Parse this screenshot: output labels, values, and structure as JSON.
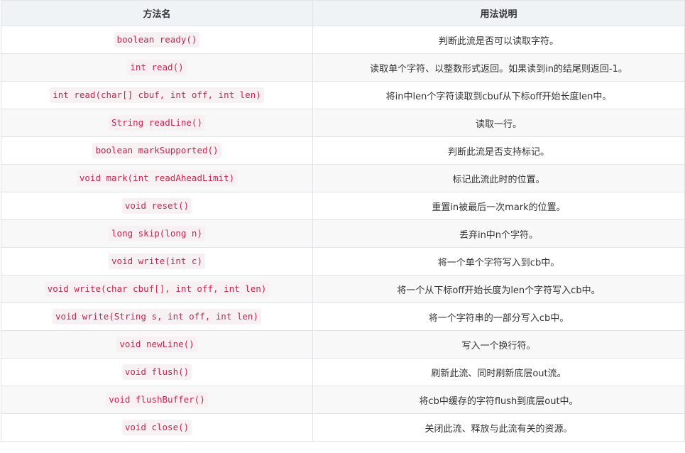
{
  "table": {
    "headers": {
      "method": "方法名",
      "description": "用法说明"
    },
    "rows": [
      {
        "method": "boolean ready()",
        "description": "判断此流是否可以读取字符。"
      },
      {
        "method": "int read()",
        "description": "读取单个字符、以整数形式返回。如果读到in的结尾则返回-1。"
      },
      {
        "method": "int read(char[] cbuf, int off, int len)",
        "description": "将in中len个字符读取到cbuf从下标off开始长度len中。"
      },
      {
        "method": "String readLine()",
        "description": "读取一行。"
      },
      {
        "method": "boolean markSupported()",
        "description": "判断此流是否支持标记。"
      },
      {
        "method": "void mark(int readAheadLimit)",
        "description": "标记此流此时的位置。"
      },
      {
        "method": "void reset()",
        "description": "重置in被最后一次mark的位置。"
      },
      {
        "method": "long skip(long n)",
        "description": "丢弃in中n个字符。"
      },
      {
        "method": "void write(int c)",
        "description": "将一个单个字符写入到cb中。"
      },
      {
        "method": "void write(char cbuf[], int off, int len)",
        "description": "将一个从下标off开始长度为len个字符写入cb中。"
      },
      {
        "method": "void write(String s, int off, int len)",
        "description": "将一个字符串的一部分写入cb中。"
      },
      {
        "method": "void newLine()",
        "description": "写入一个换行符。"
      },
      {
        "method": "void flush()",
        "description": "刷新此流、同时刷新底层out流。"
      },
      {
        "method": "void flushBuffer()",
        "description": "将cb中缓存的字符flush到底层out中。"
      },
      {
        "method": "void close()",
        "description": "关闭此流、释放与此流有关的资源。"
      }
    ]
  }
}
